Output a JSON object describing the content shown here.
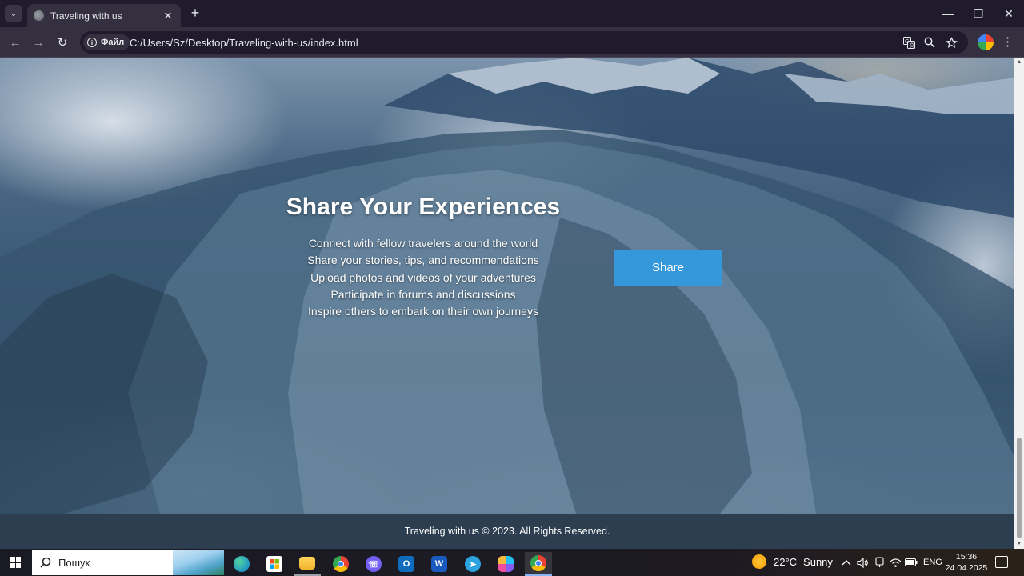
{
  "browser": {
    "tab": {
      "title": "Traveling with us",
      "close_glyph": "✕"
    },
    "new_tab_glyph": "+",
    "tab_list_glyph": "⌄",
    "window_controls": {
      "minimize": "—",
      "maximize": "❐",
      "close": "✕"
    },
    "nav": {
      "back": "←",
      "forward": "→",
      "reload": "↻"
    },
    "site_info_label": "Файл",
    "url": "C:/Users/Sz/Desktop/Traveling-with-us/index.html",
    "omnibox_icons": [
      "translate-icon",
      "zoom-icon",
      "bookmark-star-icon"
    ],
    "menu_glyph": "⋮"
  },
  "page": {
    "hero": {
      "title": "Share Your Experiences",
      "features": [
        "Connect with fellow travelers around the world",
        "Share your stories, tips, and recommendations",
        "Upload photos and videos of your adventures",
        "Participate in forums and discussions",
        "Inspire others to embark on their own journeys"
      ],
      "button_label": "Share"
    },
    "footer": {
      "text": "Traveling with us © 2023. All Rights Reserved."
    },
    "colors": {
      "accent": "#3498db",
      "footer_bg": "#2c3e50"
    }
  },
  "taskbar": {
    "search_placeholder": "Пошук",
    "apps": [
      "edge-icon",
      "store-icon",
      "file-explorer-icon",
      "chrome-icon",
      "viber-icon",
      "outlook-icon",
      "word-icon",
      "telegram-icon",
      "copilot-icon",
      "chrome-icon"
    ],
    "weather": {
      "temperature": "22°C",
      "condition": "Sunny"
    },
    "language": "ENG",
    "clock": {
      "time": "15:36",
      "date": "24.04.2025"
    }
  }
}
